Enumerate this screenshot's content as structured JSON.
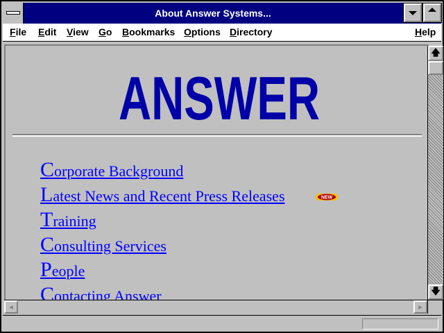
{
  "window": {
    "title": "About Answer Systems..."
  },
  "menubar": {
    "items": [
      "File",
      "Edit",
      "View",
      "Go",
      "Bookmarks",
      "Options",
      "Directory"
    ],
    "help": "Help"
  },
  "page": {
    "logo_text": "ANSWER",
    "logo_color": "#0000a8",
    "link_color": "#0000ff",
    "links": [
      {
        "first": "C",
        "rest": "orporate Background"
      },
      {
        "first": "L",
        "rest": "atest News and Recent Press Releases"
      },
      {
        "first": "T",
        "rest": "raining"
      },
      {
        "first": "C",
        "rest": "onsulting Services"
      },
      {
        "first": "P",
        "rest": "eople"
      },
      {
        "first": "C",
        "rest": "ontacting Answer"
      }
    ],
    "new_badge": "NEW"
  },
  "scrollbar": {
    "up_icon": "arrow-up-icon",
    "down_icon": "arrow-down-icon",
    "left_icon": "arrow-left-icon",
    "right_icon": "arrow-right-icon"
  },
  "statusbar": {
    "text": ""
  }
}
